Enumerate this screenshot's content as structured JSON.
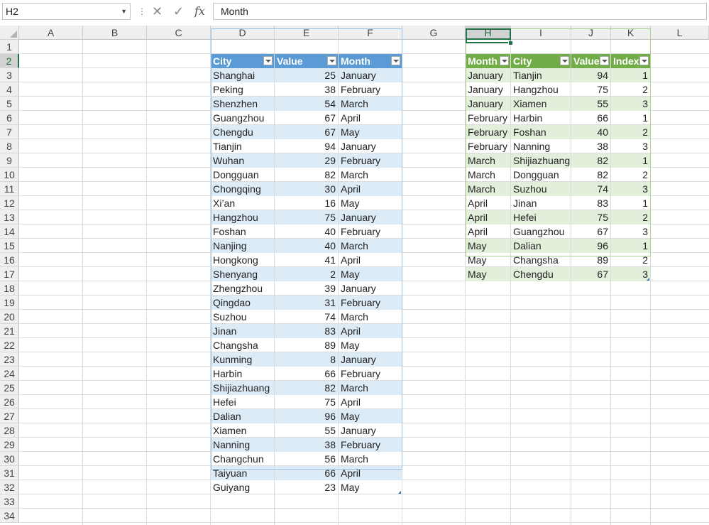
{
  "name_box": "H2",
  "formula": "Month",
  "icons": {
    "cancel": "close-icon",
    "enter": "check-icon",
    "function": "fx-icon"
  },
  "fx_label": "fx",
  "columns": [
    "A",
    "B",
    "C",
    "D",
    "E",
    "F",
    "G",
    "H",
    "I",
    "J",
    "K",
    "L"
  ],
  "rows": [
    "1",
    "2",
    "3",
    "4",
    "5",
    "6",
    "7",
    "8",
    "9",
    "10",
    "11",
    "12",
    "13",
    "14",
    "15",
    "16",
    "17",
    "18",
    "19",
    "20",
    "21",
    "22",
    "23",
    "24",
    "25",
    "26",
    "27",
    "28",
    "29",
    "30",
    "31",
    "32",
    "33",
    "34"
  ],
  "colors": {
    "blue_header": "#5b9bd5",
    "blue_band": "#ddebf7",
    "green_header": "#70ad47",
    "green_band": "#e2efda",
    "selection": "#217346"
  },
  "table1": {
    "headers": [
      "City",
      "Value",
      "Month"
    ],
    "rows": [
      [
        "Shanghai",
        "25",
        "January"
      ],
      [
        "Peking",
        "38",
        "February"
      ],
      [
        "Shenzhen",
        "54",
        "March"
      ],
      [
        "Guangzhou",
        "67",
        "April"
      ],
      [
        "Chengdu",
        "67",
        "May"
      ],
      [
        "Tianjin",
        "94",
        "January"
      ],
      [
        "Wuhan",
        "29",
        "February"
      ],
      [
        "Dongguan",
        "82",
        "March"
      ],
      [
        "Chongqing",
        "30",
        "April"
      ],
      [
        "Xi’an",
        "16",
        "May"
      ],
      [
        "Hangzhou",
        "75",
        "January"
      ],
      [
        "Foshan",
        "40",
        "February"
      ],
      [
        "Nanjing",
        "40",
        "March"
      ],
      [
        "Hongkong",
        "41",
        "April"
      ],
      [
        "Shenyang",
        "2",
        "May"
      ],
      [
        "Zhengzhou",
        "39",
        "January"
      ],
      [
        "Qingdao",
        "31",
        "February"
      ],
      [
        "Suzhou",
        "74",
        "March"
      ],
      [
        "Jinan",
        "83",
        "April"
      ],
      [
        "Changsha",
        "89",
        "May"
      ],
      [
        "Kunming",
        "8",
        "January"
      ],
      [
        "Harbin",
        "66",
        "February"
      ],
      [
        "Shijiazhuang",
        "82",
        "March"
      ],
      [
        "Hefei",
        "75",
        "April"
      ],
      [
        "Dalian",
        "96",
        "May"
      ],
      [
        "Xiamen",
        "55",
        "January"
      ],
      [
        "Nanning",
        "38",
        "February"
      ],
      [
        "Changchun",
        "56",
        "March"
      ],
      [
        "Taiyuan",
        "66",
        "April"
      ],
      [
        "Guiyang",
        "23",
        "May"
      ]
    ]
  },
  "table2": {
    "headers": [
      "Month",
      "City",
      "Value",
      "Index"
    ],
    "rows": [
      [
        "January",
        "Tianjin",
        "94",
        "1"
      ],
      [
        "January",
        "Hangzhou",
        "75",
        "2"
      ],
      [
        "January",
        "Xiamen",
        "55",
        "3"
      ],
      [
        "February",
        "Harbin",
        "66",
        "1"
      ],
      [
        "February",
        "Foshan",
        "40",
        "2"
      ],
      [
        "February",
        "Nanning",
        "38",
        "3"
      ],
      [
        "March",
        "Shijiazhuang",
        "82",
        "1"
      ],
      [
        "March",
        "Dongguan",
        "82",
        "2"
      ],
      [
        "March",
        "Suzhou",
        "74",
        "3"
      ],
      [
        "April",
        "Jinan",
        "83",
        "1"
      ],
      [
        "April",
        "Hefei",
        "75",
        "2"
      ],
      [
        "April",
        "Guangzhou",
        "67",
        "3"
      ],
      [
        "May",
        "Dalian",
        "96",
        "1"
      ],
      [
        "May",
        "Changsha",
        "89",
        "2"
      ],
      [
        "May",
        "Chengdu",
        "67",
        "3"
      ]
    ]
  }
}
